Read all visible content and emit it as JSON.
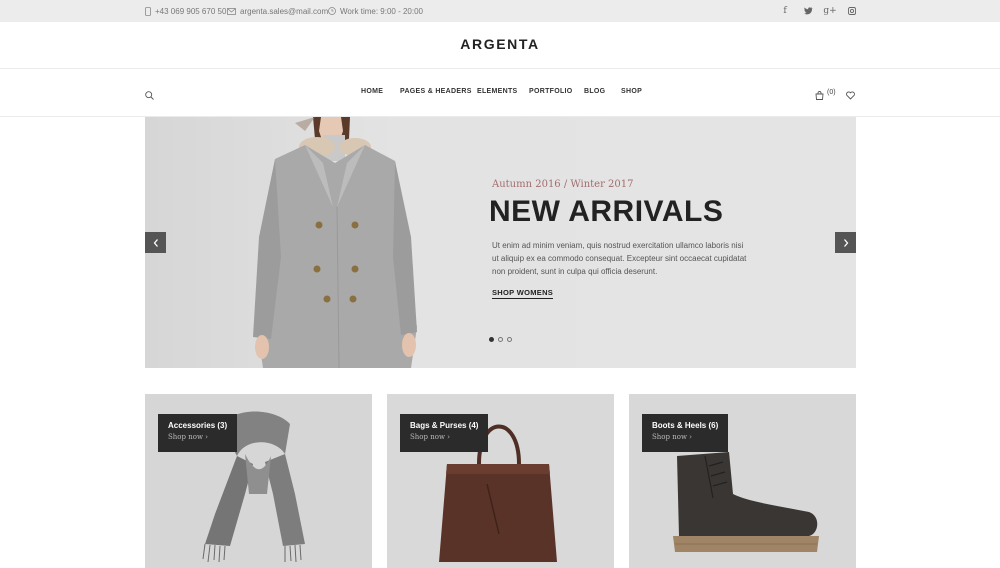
{
  "topbar": {
    "phone": "+43 069 905 670 50",
    "email": "argenta.sales@mail.com",
    "hours": "Work time: 9:00 - 20:00",
    "social": [
      {
        "icon": "facebook-icon",
        "glyph": "f"
      },
      {
        "icon": "twitter-icon",
        "glyph": "t"
      },
      {
        "icon": "google-plus-icon",
        "glyph": "g+"
      },
      {
        "icon": "instagram-icon",
        "glyph": ""
      }
    ]
  },
  "header": {
    "logo": "ARGENTA"
  },
  "nav": {
    "items": [
      "HOME",
      "PAGES & HEADERS",
      "ELEMENTS",
      "PORTFOLIO",
      "BLOG",
      "SHOP"
    ],
    "cart_count": "(0)"
  },
  "hero": {
    "subtitle": "Autumn 2016 / Winter 2017",
    "title": "NEW ARRIVALS",
    "text": "Ut enim ad minim veniam, quis nostrud exercitation ullamco laboris nisi ut aliquip ex ea commodo consequat. Excepteur sint occaecat cupidatat non proident, sunt in culpa qui officia deserunt.",
    "link": "SHOP WOMENS",
    "slides_total": 3,
    "active_slide": 1
  },
  "categories": [
    {
      "title": "Accessories (3)",
      "link": "Shop now ›"
    },
    {
      "title": "Bags & Purses (4)",
      "link": "Shop now ›"
    },
    {
      "title": "Boots & Heels (6)",
      "link": "Shop now ›"
    }
  ],
  "colors": {
    "topbar_bg": "#ececec",
    "accent": "#a26d6d",
    "dark": "#2b2b2b"
  }
}
